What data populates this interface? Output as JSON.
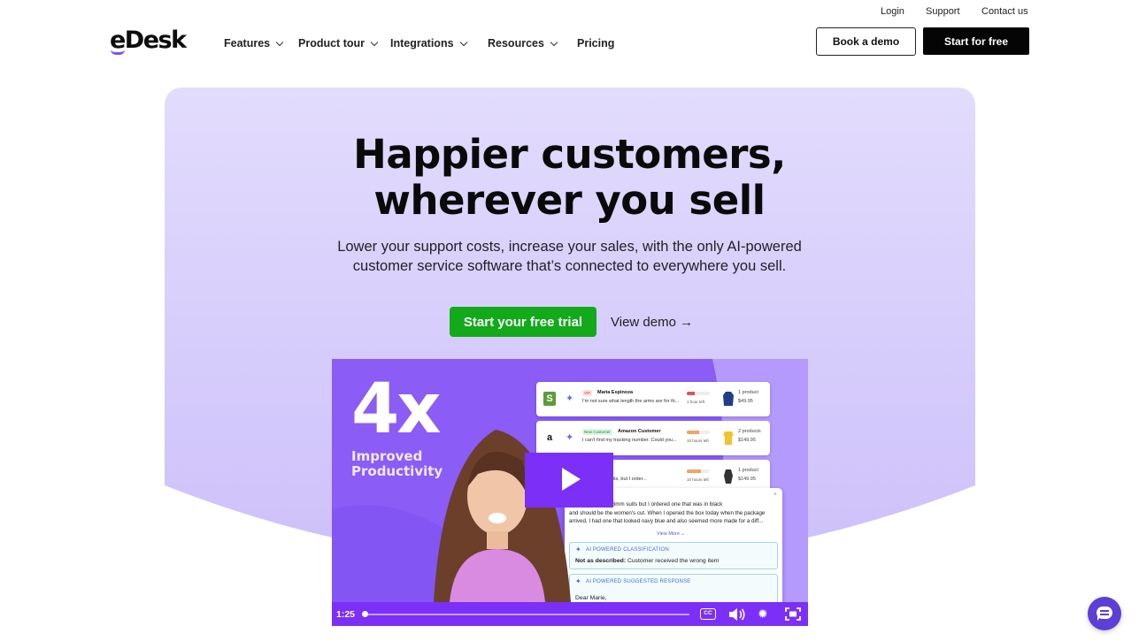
{
  "util_links": {
    "login": "Login",
    "support": "Support",
    "contact": "Contact us"
  },
  "brand": {
    "logo": "eDesk",
    "accent": "#7c4dff"
  },
  "nav": {
    "features": "Features",
    "product_tour": "Product tour",
    "integrations": "Integrations",
    "resources": "Resources",
    "pricing": "Pricing"
  },
  "header_buttons": {
    "book_demo": "Book a demo",
    "start_free": "Start for free"
  },
  "hero": {
    "title_line1": "Happier customers,",
    "title_line2": "wherever you sell",
    "subtitle_line1": "Lower your support costs, increase your sales, with the only AI-powered",
    "subtitle_line2": "customer service software that’s connected to everywhere you sell.",
    "cta_trial": "Start your free trial",
    "cta_demo": "View demo →",
    "cta_color": "#12a91a",
    "panel_color": "#d9d1fb"
  },
  "video": {
    "stat": "4x",
    "stat_label_line1": "Improved",
    "stat_label_line2": "Productivity",
    "tickets": [
      {
        "icon": "shopify-icon",
        "badge": "VIP",
        "name": "Maria Espinoza",
        "message": "I'm not sure what length the arms are for th...",
        "time_left": "1 hour left",
        "products": "1 product",
        "price": "$49.95",
        "bar_color": "#e0515b",
        "level": 0.35
      },
      {
        "icon": "amazon-icon",
        "badge": "New Customer",
        "name": "Amazon Customer",
        "message": "I can't find my tracking number. Could you...",
        "time_left": "10 hours left",
        "products": "2 products",
        "price": "$149.95",
        "bar_color": "#f0a560",
        "level": 0.55
      },
      {
        "icon": "ebay-icon",
        "badge": "",
        "name": "",
        "message": "of the 3mm suits, but I order...",
        "time_left": "10 hours left",
        "products": "1 product",
        "price": "$149.95",
        "bar_color": "#f0a560",
        "level": 0.6
      }
    ],
    "detail": {
      "body_line1": "rdered one of the 3mm suits but I ordered one that was in black",
      "body_line2": "and should be the women's cut. When I opened the box today when the package",
      "body_line3": "arrived, I had one that looked navy blue and also seemed more made for a diff...",
      "view_more": "View More ⌄",
      "classification_label": "AI POWERED CLASSIFICATION",
      "classification_key": "Not as described:",
      "classification_value": "Customer received the wrong item",
      "response_label": "AI POWERED SUGGESTED RESPONSE",
      "response_greeting": "Dear Marie,"
    },
    "controls": {
      "time": "1:25",
      "cc": "CC",
      "progress": 0.0
    }
  },
  "chat_widget": {
    "icon": "chat-bubble-icon"
  }
}
